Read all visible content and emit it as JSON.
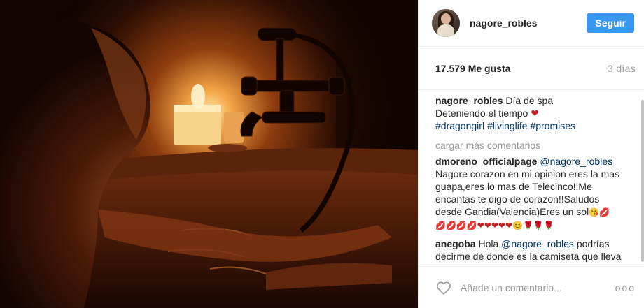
{
  "header": {
    "username": "nagore_robles",
    "follow_label": "Seguir"
  },
  "stats": {
    "likes": "17.579 Me gusta",
    "age": "3 días"
  },
  "caption": {
    "username": "nagore_robles",
    "line1": "Día de spa",
    "line2": "Deteniendo el tiempo",
    "heart": "❤",
    "hashtags": [
      "#dragongirl",
      "#livinglife",
      "#promises"
    ]
  },
  "load_more": "cargar más comentarios",
  "comments": [
    {
      "username": "dmoreno_officialpage",
      "mention": "@nagore_robles",
      "text": "Nagore corazon en mi opinion eres la mas guapa,eres lo mas de Telecinco!!Me encantas te digo de corazon!!Saludos desde Gandia(Valencia)Eres un sol",
      "emoji_tail": "😘💋",
      "emoji_line": "💋💋💋💋❤❤❤❤❤😊🌹🌹🌹"
    },
    {
      "username": "anegoba",
      "prefix": "Hola",
      "mention": "@nagore_robles",
      "text": "podrías decirme de donde es la camiseta que lleva puesta?"
    }
  ],
  "footer": {
    "placeholder": "Añade un comentario...",
    "more_label": "ooo"
  },
  "icons": {
    "heart": "heart-outline-icon",
    "more": "more-options-icon"
  },
  "colors": {
    "follow_button": "#3897f0",
    "link": "#003569",
    "muted": "#999999"
  }
}
